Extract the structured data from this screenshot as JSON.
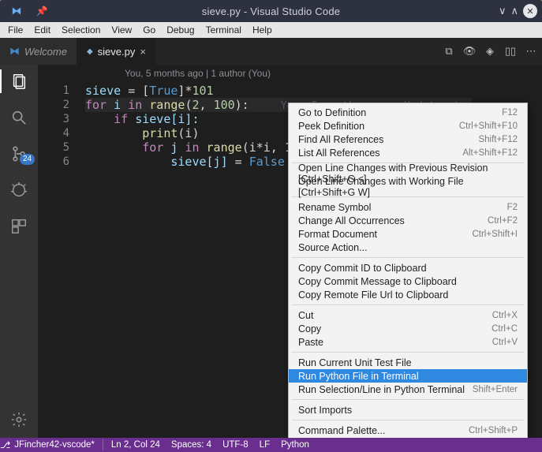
{
  "titlebar": {
    "title": "sieve.py - Visual Studio Code"
  },
  "menubar": [
    "File",
    "Edit",
    "Selection",
    "View",
    "Go",
    "Debug",
    "Terminal",
    "Help"
  ],
  "tabs": {
    "welcome": "Welcome",
    "sieve": "sieve.py"
  },
  "activitybar": {
    "badge": "24"
  },
  "codelens": "You, 5 months ago | 1 author (You)",
  "lines": [
    "1",
    "2",
    "3",
    "4",
    "5",
    "6"
  ],
  "code": {
    "l1": {
      "sieve": "sieve ",
      "eq": "= ",
      "lb": "[",
      "true": "True",
      "rb": "]",
      "mul": "*",
      "num": "101"
    },
    "l2": {
      "for": "for ",
      "i": "i ",
      "in": "in ",
      "range": "range",
      "p": "(",
      "a": "2",
      "c": ", ",
      "b": "100",
      "q": "):",
      "note": "You, 5 months ago • Updates to "
    },
    "l3": {
      "if": "if ",
      "expr": "sieve[i]:"
    },
    "l4": {
      "print": "print",
      "p": "(i)"
    },
    "l5": {
      "for": "for ",
      "j": "j ",
      "in": "in ",
      "range": "range",
      "args": "(i*i, 1"
    },
    "l6": {
      "lhs": "sieve[j] ",
      "eq": "= ",
      "false": "False"
    }
  },
  "ctx": [
    {
      "kind": "item",
      "label": "Go to Definition",
      "key": "F12"
    },
    {
      "kind": "item",
      "label": "Peek Definition",
      "key": "Ctrl+Shift+F10"
    },
    {
      "kind": "item",
      "label": "Find All References",
      "key": "Shift+F12"
    },
    {
      "kind": "item",
      "label": "List All References",
      "key": "Alt+Shift+F12"
    },
    {
      "kind": "sep"
    },
    {
      "kind": "item",
      "label": "Open Line Changes with Previous Revision [Ctrl+Shift+G <]",
      "key": ""
    },
    {
      "kind": "item",
      "label": "Open Line Changes with Working File [Ctrl+Shift+G W]",
      "key": ""
    },
    {
      "kind": "sep"
    },
    {
      "kind": "item",
      "label": "Rename Symbol",
      "key": "F2"
    },
    {
      "kind": "item",
      "label": "Change All Occurrences",
      "key": "Ctrl+F2"
    },
    {
      "kind": "item",
      "label": "Format Document",
      "key": "Ctrl+Shift+I"
    },
    {
      "kind": "item",
      "label": "Source Action...",
      "key": ""
    },
    {
      "kind": "sep"
    },
    {
      "kind": "item",
      "label": "Copy Commit ID to Clipboard",
      "key": ""
    },
    {
      "kind": "item",
      "label": "Copy Commit Message to Clipboard",
      "key": ""
    },
    {
      "kind": "item",
      "label": "Copy Remote File Url to Clipboard",
      "key": ""
    },
    {
      "kind": "sep"
    },
    {
      "kind": "item",
      "label": "Cut",
      "key": "Ctrl+X"
    },
    {
      "kind": "item",
      "label": "Copy",
      "key": "Ctrl+C"
    },
    {
      "kind": "item",
      "label": "Paste",
      "key": "Ctrl+V"
    },
    {
      "kind": "sep"
    },
    {
      "kind": "item",
      "label": "Run Current Unit Test File",
      "key": ""
    },
    {
      "kind": "item",
      "label": "Run Python File in Terminal",
      "key": "",
      "hi": true
    },
    {
      "kind": "item",
      "label": "Run Selection/Line in Python Terminal",
      "key": "Shift+Enter"
    },
    {
      "kind": "sep"
    },
    {
      "kind": "item",
      "label": "Sort Imports",
      "key": ""
    },
    {
      "kind": "sep"
    },
    {
      "kind": "item",
      "label": "Command Palette...",
      "key": "Ctrl+Shift+P"
    }
  ],
  "status": {
    "branch": "JFincher42-vscode*",
    "lncol": "Ln 2, Col 24",
    "spaces": "Spaces: 4",
    "enc": "UTF-8",
    "eol": "LF",
    "lang": "Python"
  }
}
